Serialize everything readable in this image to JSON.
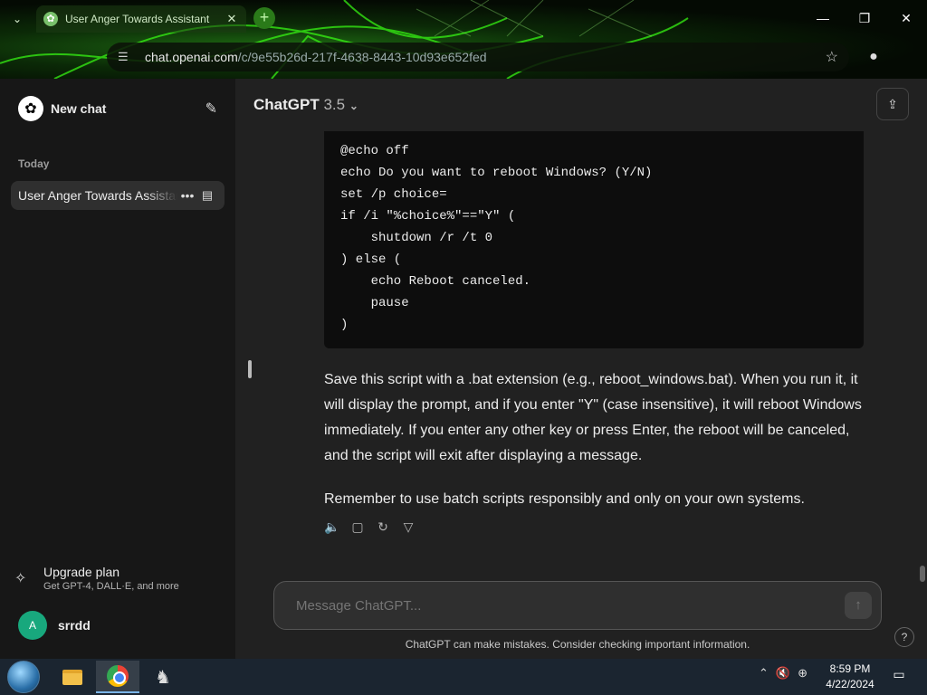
{
  "browser": {
    "tab_title": "User Anger Towards Assistant",
    "url_domain": "chat.openai.com",
    "url_path": "/c/9e55b26d-217f-4638-8443-10d93e652fed"
  },
  "sidebar": {
    "new_chat_label": "New chat",
    "section_today": "Today",
    "history": [
      {
        "label": "User Anger Towards Assistant"
      }
    ],
    "upgrade_title": "Upgrade plan",
    "upgrade_subtitle": "Get GPT-4, DALL·E, and more",
    "user_initial": "A",
    "user_name": "srrdd"
  },
  "header": {
    "model_name": "ChatGPT",
    "model_version": "3.5"
  },
  "code_lines": [
    "@echo off",
    "echo Do you want to reboot Windows? (Y/N)",
    "set /p choice=",
    "if /i \"%choice%\"==\"Y\" (",
    "    shutdown /r /t 0",
    ") else (",
    "    echo Reboot canceled.",
    "    pause",
    ")"
  ],
  "message": {
    "paragraph1": "Save this script with a .bat extension (e.g., reboot_windows.bat). When you run it, it will display the prompt, and if you enter \"Y\" (case insensitive), it will reboot Windows immediately. If you enter any other key or press Enter, the reboot will be canceled, and the script will exit after displaying a message.",
    "paragraph2": "Remember to use batch scripts responsibly and only on your own systems."
  },
  "composer": {
    "placeholder": "Message ChatGPT..."
  },
  "disclaimer": "ChatGPT can make mistakes. Consider checking important information.",
  "help_label": "?",
  "taskbar": {
    "time": "8:59 PM",
    "date": "4/22/2024"
  },
  "icons": [
    "search-icon",
    "tune-icon",
    "star-icon",
    "profile-icon",
    "edit-icon",
    "ellipsis-icon",
    "archive-icon",
    "sparkle-icon",
    "share-icon",
    "speaker-icon",
    "copy-icon",
    "regenerate-icon",
    "thumbs-down-icon",
    "send-arrow-icon"
  ]
}
